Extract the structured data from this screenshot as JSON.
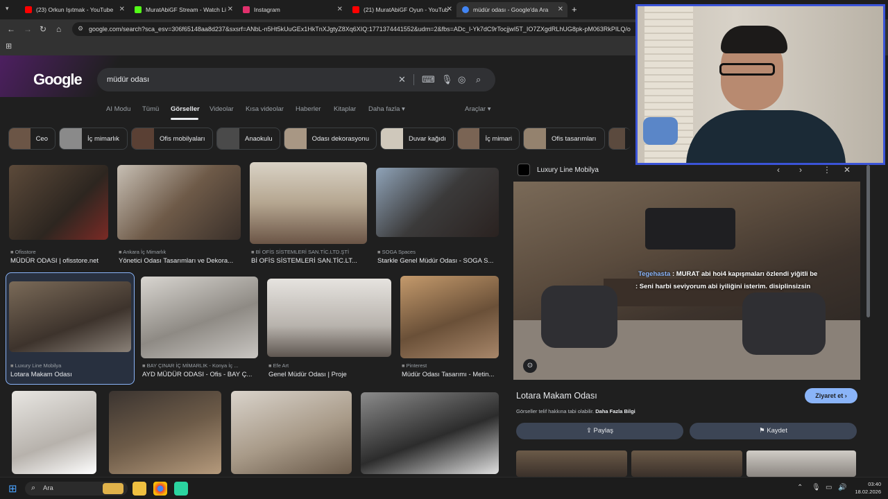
{
  "browser": {
    "tabs": [
      {
        "title": "(23) Orkun Işıtmak - YouTube",
        "color": "#ff0000"
      },
      {
        "title": "MuratAbiGF Stream - Watch Li",
        "color": "#53fc18"
      },
      {
        "title": "Instagram",
        "color": "#e1306c"
      },
      {
        "title": "(21) MuratAbiGF Oyun - YouTub",
        "color": "#ff0000"
      },
      {
        "title": "müdür odası - Google'da Ara",
        "color": "#4285f4"
      }
    ],
    "new_tab": "+",
    "url": "google.com/search?sca_esv=306f65148aa8d237&sxsrf=ANbL-n5Ht5kUuGEx1HkTnXJgtyZ8Xq6XIQ:1771374441552&udm=2&fbs=ADc_I-Yk7dC9rTocjjwI5T_IO7ZXgdRLhUG8pk-pM063RkPILQ/o"
  },
  "google": {
    "logo": "Google",
    "query": "müdür odası",
    "nav_tabs": [
      "AI Modu",
      "Tümü",
      "Görseller",
      "Videolar",
      "Kısa videolar",
      "Haberler",
      "Kitaplar",
      "Daha fazla ▾"
    ],
    "tools": "Araçlar ▾",
    "chips": [
      "Ceo",
      "İç mimarlık",
      "Ofis mobilyaları",
      "Anaokulu",
      "Odası dekorasyonu",
      "Duvar kağıdı",
      "İç mimari",
      "Ofis tasarımları"
    ],
    "results": [
      {
        "source": "Ofisstore",
        "title": "MÜDÜR ODASI | ofisstore.net"
      },
      {
        "source": "Ankara İç Mimarlık",
        "title": "Yönetici Odası Tasarımları ve Dekora..."
      },
      {
        "source": "Bİ OFİS SİSTEMLERİ SAN.TİC.LTD.ŞTİ",
        "title": "Bİ OFİS SİSTEMLERİ SAN.TİC.LT..."
      },
      {
        "source": "SOGA Spaces",
        "title": "Starkle Genel Müdür Odası - SOGA S..."
      },
      {
        "source": "Luxury Line Mobilya",
        "title": "Lotara Makam Odası"
      },
      {
        "source": "BAY ÇINAR İÇ MİMARLIK - Konya İç ...",
        "title": "AYD MÜDÜR ODASI - Ofis - BAY Ç..."
      },
      {
        "source": "Efe Art",
        "title": "Genel Müdür Odası | Proje"
      },
      {
        "source": "Pinterest",
        "title": "Müdür Odası Tasarımı - Metin..."
      }
    ],
    "preview": {
      "source": "Luxury Line Mobilya",
      "title": "Lotara Makam Odası",
      "visit": "Ziyaret et ›",
      "copyright": "Görseller telif hakkına tabi olabilir.",
      "more_info": "Daha Fazla Bilgi",
      "share": "Paylaş",
      "save": "Kaydet"
    }
  },
  "chat": {
    "user": "Tegehasta",
    "line1": ": MURAT abi hoi4 kapışmaları özlendi yiğitli be",
    "line2": ": Seni harbi seviyorum abi iyiliğini isterim. disiplinsizsin"
  },
  "taskbar": {
    "search": "Ara",
    "time": "03:40",
    "date": "18.02.2026"
  },
  "colors": {
    "accent": "#8ab4f8",
    "webcam_border": "#3b54d8"
  }
}
